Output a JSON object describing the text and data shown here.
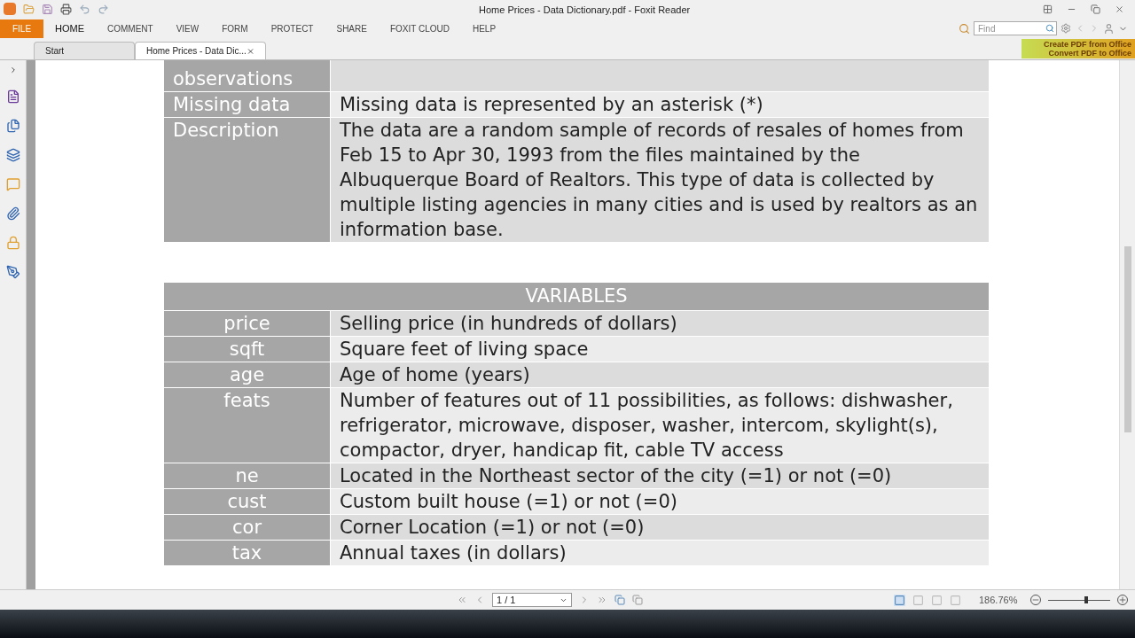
{
  "window": {
    "title": "Home Prices - Data Dictionary.pdf - Foxit Reader"
  },
  "menu": [
    {
      "label": "FILE",
      "selected": false,
      "kind": "file"
    },
    {
      "label": "HOME",
      "selected": true,
      "kind": "tab"
    },
    {
      "label": "COMMENT",
      "selected": false,
      "kind": "tab"
    },
    {
      "label": "VIEW",
      "selected": false,
      "kind": "tab"
    },
    {
      "label": "FORM",
      "selected": false,
      "kind": "tab"
    },
    {
      "label": "PROTECT",
      "selected": false,
      "kind": "tab"
    },
    {
      "label": "SHARE",
      "selected": false,
      "kind": "tab"
    },
    {
      "label": "FOXIT CLOUD",
      "selected": false,
      "kind": "tab"
    },
    {
      "label": "HELP",
      "selected": false,
      "kind": "tab"
    }
  ],
  "search": {
    "placeholder": "Find"
  },
  "promo": [
    "Create PDF from Office",
    "Convert PDF to Office"
  ],
  "doc_tabs": [
    {
      "label": "Start",
      "selected": false,
      "closable": false
    },
    {
      "label": "Home Prices - Data Dic...",
      "selected": true,
      "closable": true
    }
  ],
  "info_rows": [
    {
      "label": "observations"
    },
    {
      "label": "Missing data",
      "value": "Missing data is represented by an asterisk (*)"
    },
    {
      "label": "Description",
      "value": "The data are a random sample of records of resales of homes from Feb 15 to Apr 30, 1993 from the files maintained by the Albuquerque Board of Realtors. This type of data is collected by multiple listing agencies in many cities and is used by realtors as an information base."
    }
  ],
  "variables": {
    "heading": "VARIABLES",
    "rows": [
      {
        "name": "price",
        "description": "Selling price (in hundreds of dollars)"
      },
      {
        "name": "sqft",
        "description": "Square feet of living space"
      },
      {
        "name": "age",
        "description": "Age of home (years)"
      },
      {
        "name": "feats",
        "description": "Number of features out of 11 possibilities, as follows: dishwasher, refrigerator, microwave, disposer, washer, intercom, skylight(s), compactor, dryer, handicap fit, cable TV access"
      },
      {
        "name": "ne",
        "description": "Located in the Northeast sector of the city (=1) or not (=0)"
      },
      {
        "name": "cust",
        "description": "Custom built house (=1) or not (=0)"
      },
      {
        "name": "cor",
        "description": "Corner Location (=1) or not (=0)"
      },
      {
        "name": "tax",
        "description": "Annual taxes (in dollars)"
      }
    ]
  },
  "status_bar": {
    "page": "1 / 1",
    "zoom": "186.76%",
    "level": 0.62
  }
}
